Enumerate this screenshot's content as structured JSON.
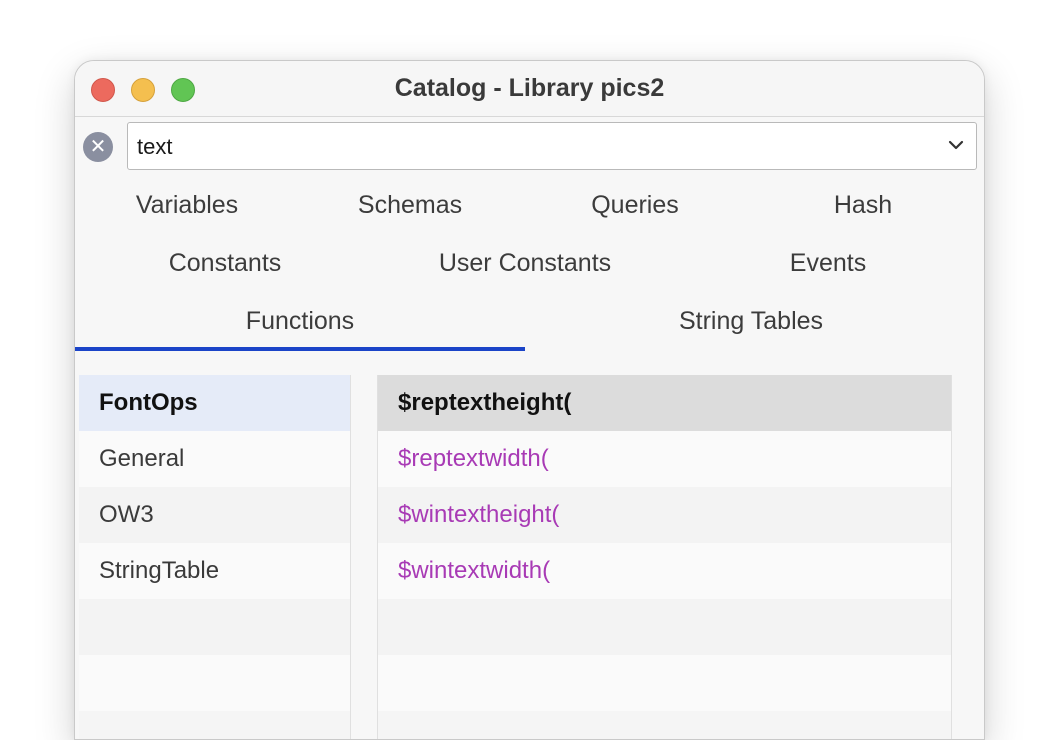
{
  "window": {
    "title": "Catalog - Library pics2"
  },
  "search": {
    "value": "text"
  },
  "tabs": [
    {
      "label": "Variables"
    },
    {
      "label": "Schemas"
    },
    {
      "label": "Queries"
    },
    {
      "label": "Hash"
    },
    {
      "label": "Constants"
    },
    {
      "label": "User Constants"
    },
    {
      "label": "Events"
    },
    {
      "label": "Functions",
      "selected": true
    },
    {
      "label": "String Tables"
    }
  ],
  "categories": [
    {
      "label": "FontOps",
      "selected": true
    },
    {
      "label": "General"
    },
    {
      "label": "OW3"
    },
    {
      "label": "StringTable"
    }
  ],
  "functions": [
    {
      "label": "$reptextheight(",
      "selected": true
    },
    {
      "label": "$reptextwidth("
    },
    {
      "label": "$wintextheight("
    },
    {
      "label": "$wintextwidth("
    }
  ],
  "colors": {
    "accent": "#1b44c8",
    "function_text": "#a83ab5",
    "selected_category_bg": "#e5ebf8",
    "selected_function_bg": "#dcdcdc"
  },
  "icons": {
    "clear": "clear-icon",
    "dropdown": "chevron-down-icon"
  }
}
